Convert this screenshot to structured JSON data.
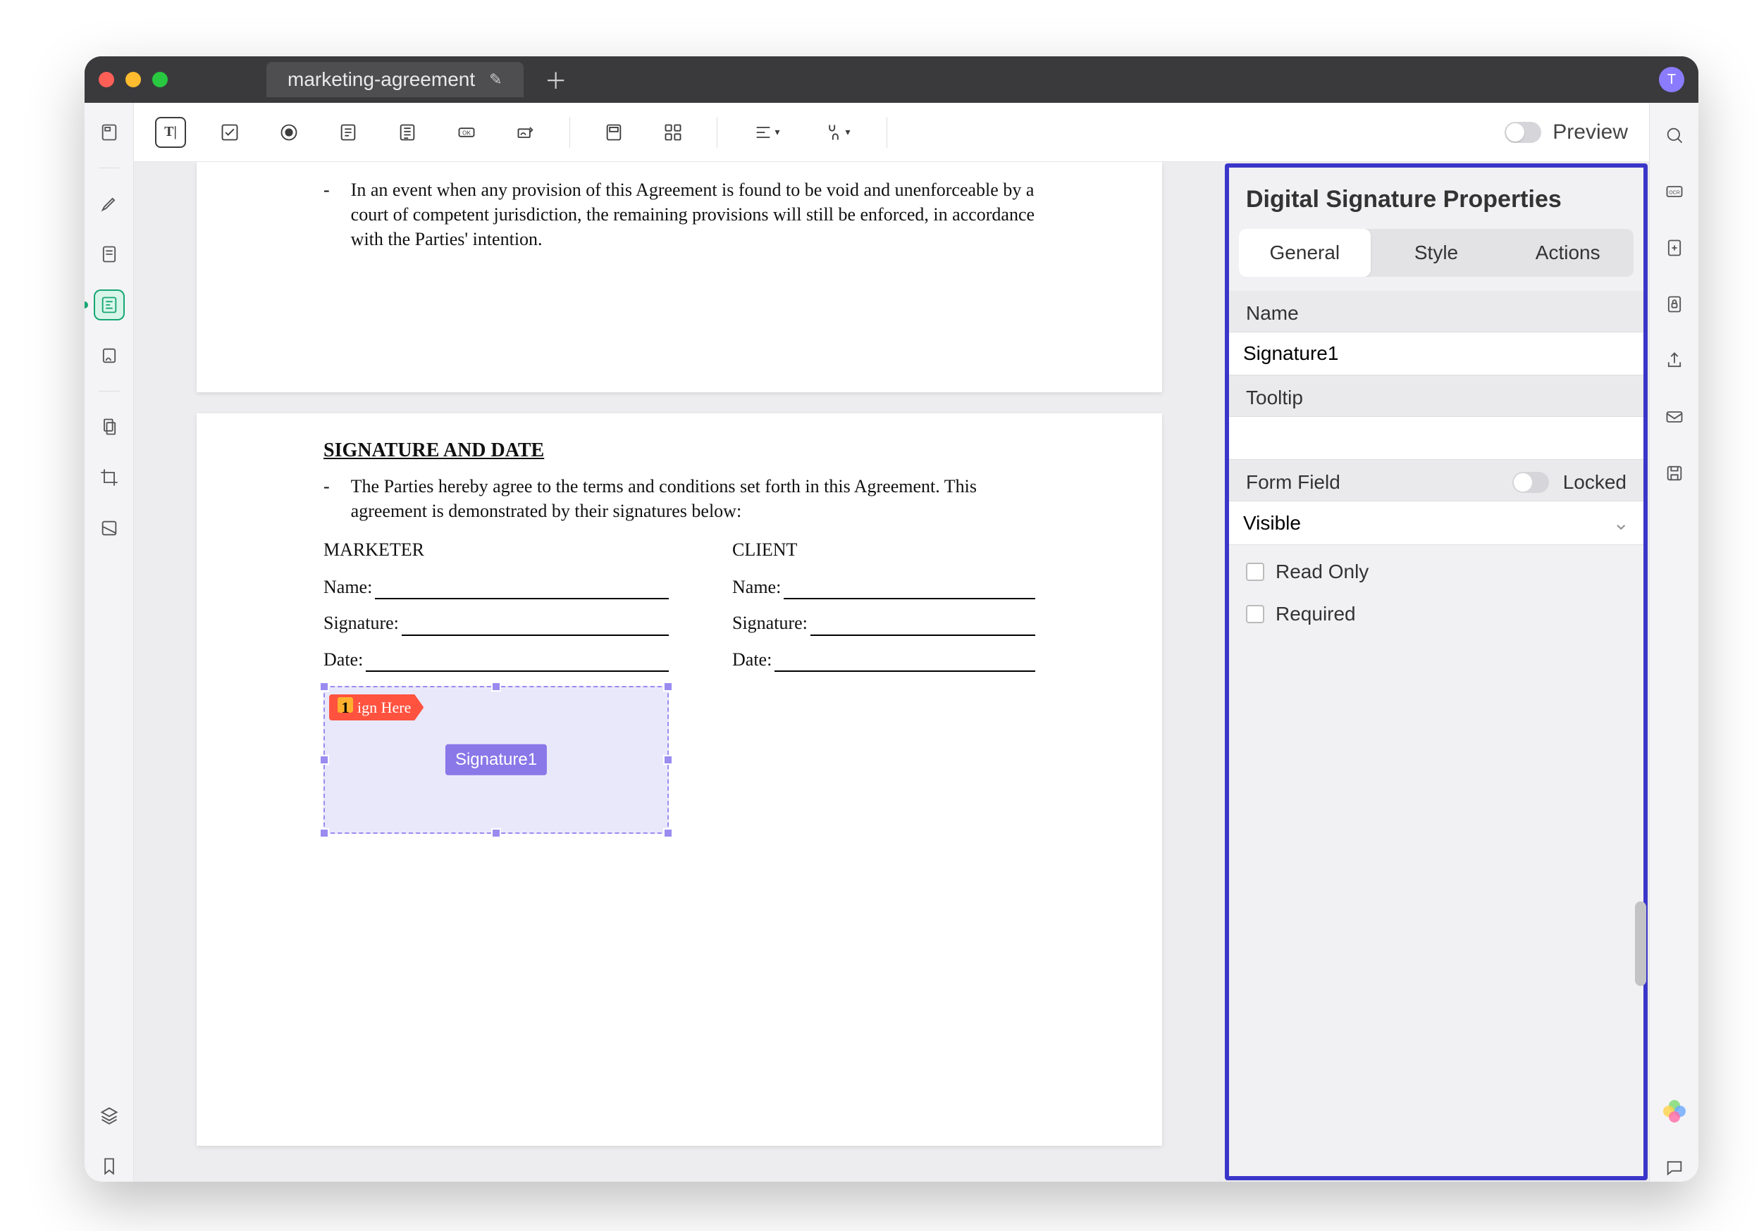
{
  "tab": {
    "title": "marketing-agreement"
  },
  "avatar_letter": "T",
  "toolbar": {
    "preview": "Preview",
    "t_label": "T|"
  },
  "doc": {
    "frag_text": "In an event when any provision of this Agreement is found to be void and unenforceable by a court of competent jurisdiction, the remaining provisions will still be enforced, in accordance with the Parties' intention.",
    "sig_heading": "SIGNATURE AND DATE",
    "sig_intro": "The Parties hereby agree to the terms and conditions set forth in this Agreement. This agreement is demonstrated by their signatures below:",
    "cols": {
      "left_title": "MARKETER",
      "right_title": "CLIENT",
      "name": "Name:",
      "signature": "Signature:",
      "date": "Date:"
    },
    "signhere_num": "1",
    "signhere_text": "ign Here",
    "sig_field_label": "Signature1"
  },
  "panel": {
    "title": "Digital Signature Properties",
    "tabs": {
      "general": "General",
      "style": "Style",
      "actions": "Actions"
    },
    "name_label": "Name",
    "name_value": "Signature1",
    "tooltip_label": "Tooltip",
    "tooltip_value": "",
    "formfield_label": "Form Field",
    "locked_label": "Locked",
    "visibility": "Visible",
    "readonly": "Read Only",
    "required": "Required"
  }
}
